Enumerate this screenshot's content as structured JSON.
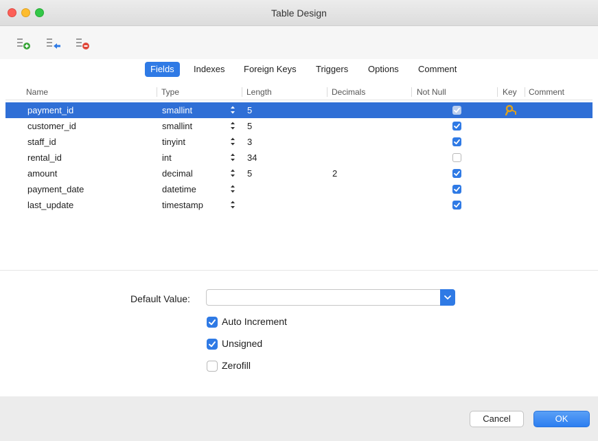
{
  "window": {
    "title": "Table Design"
  },
  "toolbar": {
    "buttons": [
      {
        "icon": "add-field-icon"
      },
      {
        "icon": "insert-field-icon"
      },
      {
        "icon": "delete-field-icon"
      }
    ]
  },
  "tabs": [
    "Fields",
    "Indexes",
    "Foreign Keys",
    "Triggers",
    "Options",
    "Comment"
  ],
  "active_tab": "Fields",
  "columns": [
    "Name",
    "Type",
    "Length",
    "Decimals",
    "Not Null",
    "Key",
    "Comment"
  ],
  "rows": [
    {
      "name": "payment_id",
      "type": "smallint",
      "length": "5",
      "decimals": "",
      "not_null": true,
      "key": true,
      "selected": true
    },
    {
      "name": "customer_id",
      "type": "smallint",
      "length": "5",
      "decimals": "",
      "not_null": true,
      "key": false,
      "selected": false
    },
    {
      "name": "staff_id",
      "type": "tinyint",
      "length": "3",
      "decimals": "",
      "not_null": true,
      "key": false,
      "selected": false
    },
    {
      "name": "rental_id",
      "type": "int",
      "length": "34",
      "decimals": "",
      "not_null": false,
      "key": false,
      "selected": false
    },
    {
      "name": "amount",
      "type": "decimal",
      "length": "5",
      "decimals": "2",
      "not_null": true,
      "key": false,
      "selected": false
    },
    {
      "name": "payment_date",
      "type": "datetime",
      "length": "",
      "decimals": "",
      "not_null": true,
      "key": false,
      "selected": false
    },
    {
      "name": "last_update",
      "type": "timestamp",
      "length": "",
      "decimals": "",
      "not_null": true,
      "key": false,
      "selected": false
    }
  ],
  "field_props": {
    "default_value_label": "Default Value:",
    "default_value": "",
    "options": [
      {
        "label": "Auto Increment",
        "checked": true
      },
      {
        "label": "Unsigned",
        "checked": true
      },
      {
        "label": "Zerofill",
        "checked": false
      }
    ]
  },
  "footer": {
    "cancel_label": "Cancel",
    "ok_label": "OK"
  },
  "colors": {
    "accent": "#2f7ae5",
    "selection": "#2f6fd6",
    "key_icon": "#e0a21a"
  }
}
